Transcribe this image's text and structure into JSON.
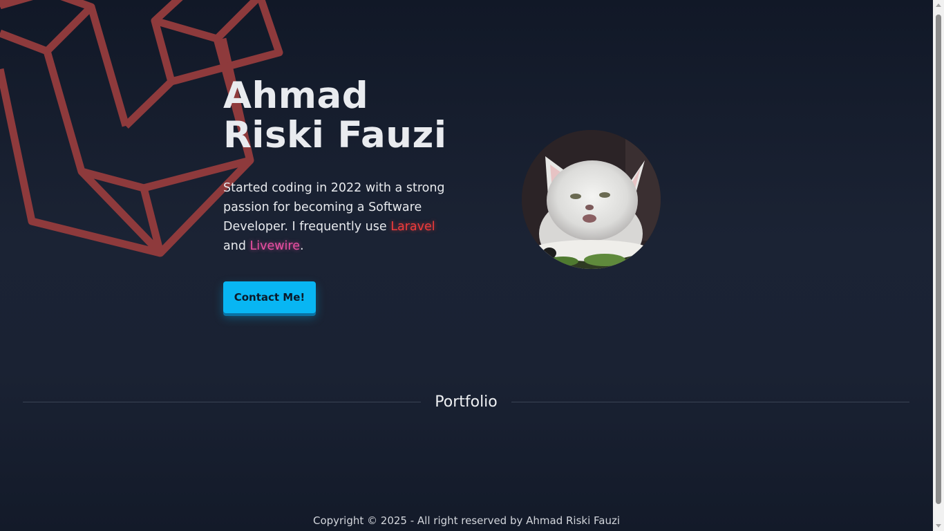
{
  "hero": {
    "name": "Ahmad Riski Fauzi",
    "bio_before": "Started coding in 2022 with a strong passion for becoming a Software Developer. I frequently use ",
    "highlight_laravel": "Laravel",
    "bio_and": " and ",
    "highlight_livewire": "Livewire",
    "bio_end": ".",
    "contact_label": "Contact Me!",
    "avatar_alt": "avatar-cat-icon"
  },
  "portfolio": {
    "heading": "Portfolio"
  },
  "footer": {
    "copyright": "Copyright © 2025 - All right reserved by Ahmad Riski Fauzi"
  },
  "colors": {
    "background": "#111827",
    "accent": "#08b6f3",
    "laravel_red": "#ef3b3b",
    "livewire_pink": "#ec4fa3",
    "logo_stroke": "#8e3a3c"
  },
  "icons": {
    "background_logo": "laravel-logo-icon"
  }
}
